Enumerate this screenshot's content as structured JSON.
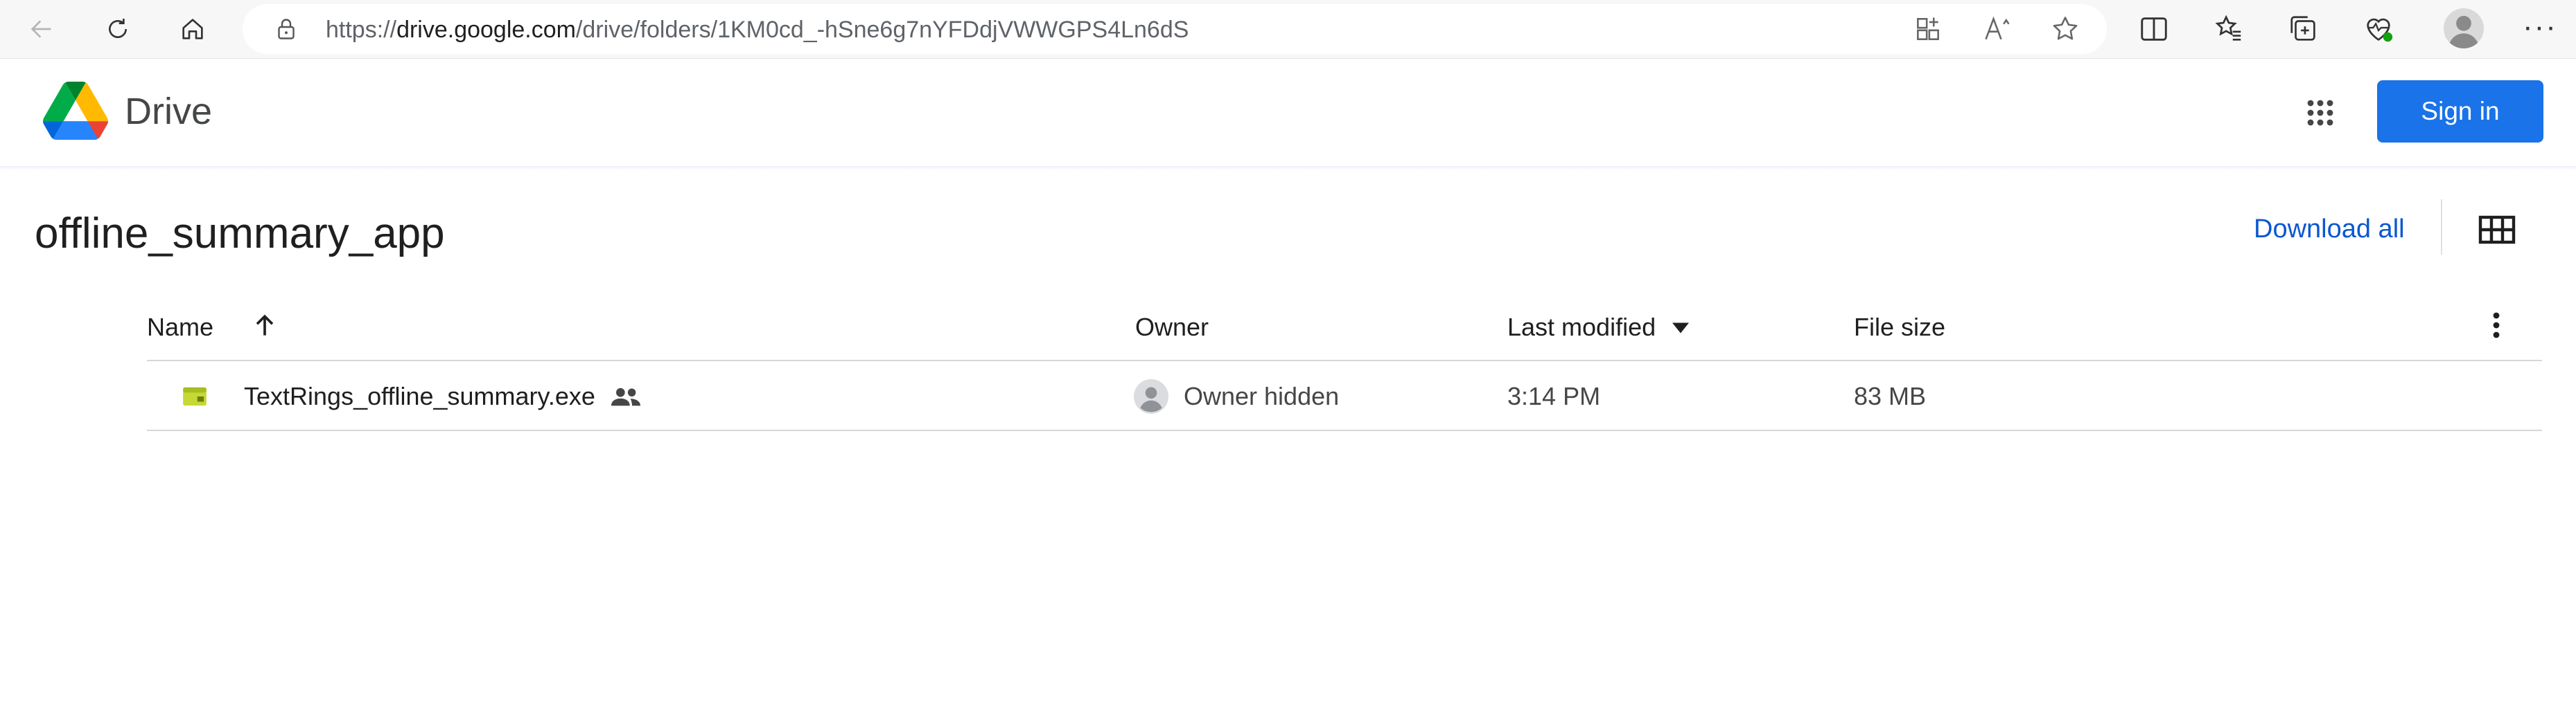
{
  "browser": {
    "url_prefix": "https://",
    "url_host": "drive.google.com",
    "url_path": "/drive/folders/1KM0cd_-hSne6g7nYFDdjVWWGPS4Ln6dS",
    "more_label": "···"
  },
  "app": {
    "name": "Drive",
    "sign_in_label": "Sign in",
    "brand_color": "#1a73e8"
  },
  "folder": {
    "title": "offline_summary_app",
    "download_all_label": "Download all"
  },
  "table": {
    "columns": {
      "name": "Name",
      "owner": "Owner",
      "last_modified": "Last modified",
      "file_size": "File size"
    },
    "rows": [
      {
        "name": "TextRings_offline_summary.exe",
        "owner": "Owner hidden",
        "last_modified": "3:14 PM",
        "file_size": "83 MB",
        "icon": "executable-file-icon",
        "shared": true
      }
    ]
  }
}
